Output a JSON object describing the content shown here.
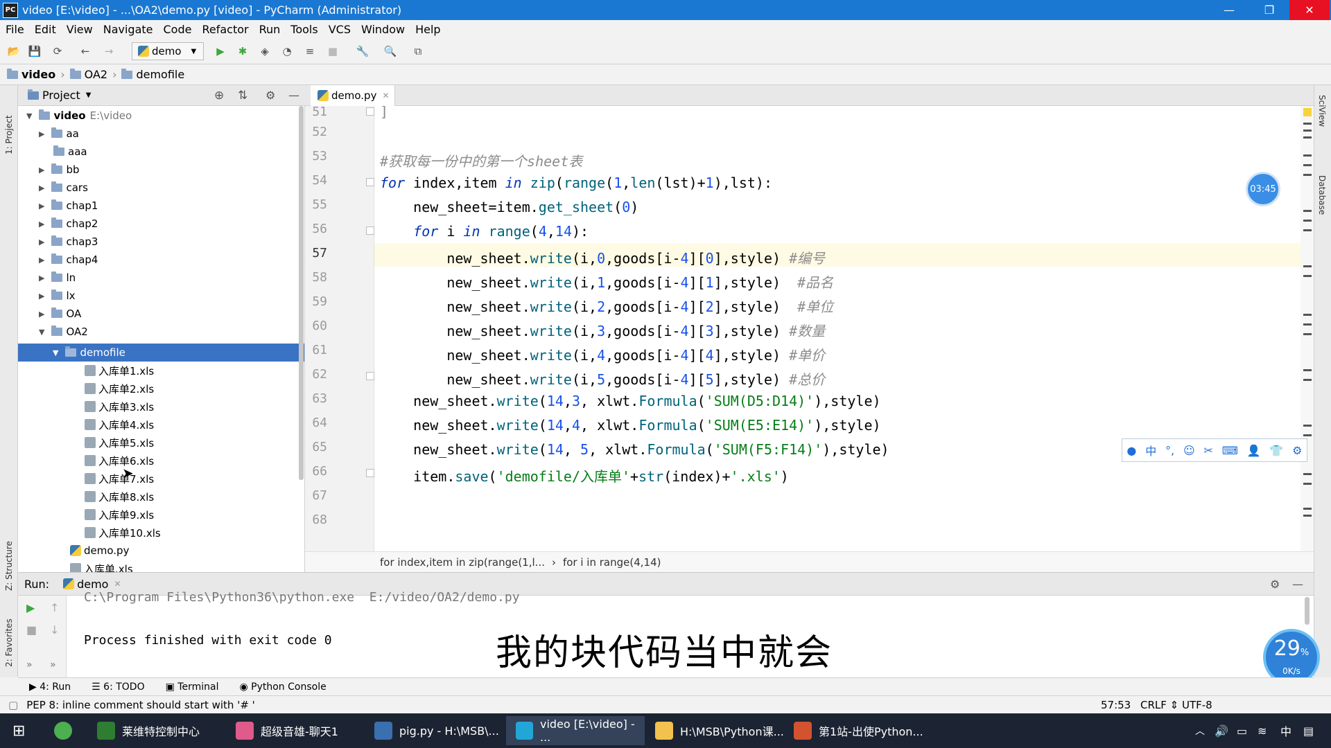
{
  "window": {
    "title": "video [E:\\video] - ...\\OA2\\demo.py [video] - PyCharm (Administrator)",
    "icon_text": "PC",
    "minimize": "—",
    "restore": "❐",
    "close": "✕"
  },
  "menu": [
    "File",
    "Edit",
    "View",
    "Navigate",
    "Code",
    "Refactor",
    "Run",
    "Tools",
    "VCS",
    "Window",
    "Help"
  ],
  "toolbar": {
    "run_config": "demo"
  },
  "navbar": {
    "crumbs": [
      "video",
      "OA2",
      "demofile"
    ]
  },
  "left_strip": {
    "project": "1: Project",
    "structure": "Z: Structure",
    "favorites": "2: Favorites"
  },
  "right_strip": {
    "sciview": "SciView",
    "database": "Database"
  },
  "project": {
    "header": "Project",
    "root": {
      "name": "video",
      "path": "E:\\video"
    },
    "items": [
      {
        "label": "aa"
      },
      {
        "label": "aaa"
      },
      {
        "label": "bb"
      },
      {
        "label": "cars"
      },
      {
        "label": "chap1"
      },
      {
        "label": "chap2"
      },
      {
        "label": "chap3"
      },
      {
        "label": "chap4"
      },
      {
        "label": "ln"
      },
      {
        "label": "lx"
      },
      {
        "label": "OA"
      },
      {
        "label": "OA2"
      },
      {
        "label": "demofile"
      },
      {
        "label": "入库单1.xls"
      },
      {
        "label": "入库单2.xls"
      },
      {
        "label": "入库单3.xls"
      },
      {
        "label": "入库单4.xls"
      },
      {
        "label": "入库单5.xls"
      },
      {
        "label": "入库单6.xls"
      },
      {
        "label": "入库单7.xls"
      },
      {
        "label": "入库单8.xls"
      },
      {
        "label": "入库单9.xls"
      },
      {
        "label": "入库单10.xls"
      },
      {
        "label": "demo.py"
      },
      {
        "label": "入库单.xls"
      }
    ]
  },
  "editor": {
    "tab": "demo.py",
    "line_numbers": [
      "51",
      "52",
      "53",
      "54",
      "55",
      "56",
      "57",
      "58",
      "59",
      "60",
      "61",
      "62",
      "63",
      "64",
      "65",
      "66",
      "67",
      "68"
    ],
    "comment_53": "#获取每一份中的第一个sheet表",
    "c57": "#编号",
    "c58": "#品名",
    "c59": "#单位",
    "c60": "#数量",
    "c61": "#单价",
    "c62": "#总价",
    "f63": "'SUM(D5:D14)'",
    "f64": "'SUM(E5:E14)'",
    "f65": "'SUM(F5:F14)'",
    "s66a": "'demofile/入库单'",
    "s66b": "'.xls'",
    "breadcrumb_1": "for index,item in zip(range(1,l...",
    "breadcrumb_2": "for i in range(4,14)",
    "timer": "03:45"
  },
  "run": {
    "label": "Run:",
    "tab": "demo",
    "cmd": "C:\\Program Files\\Python36\\python.exe  E:/video/OA2/demo.py",
    "output": "Process finished with exit code 0"
  },
  "subtitle": "我的块代码当中就会",
  "bottom_tabs": [
    "4: Run",
    "6: TODO",
    "Terminal",
    "Python Console"
  ],
  "status": {
    "message": "PEP 8: inline comment should start with '# '",
    "position": "57:53",
    "line_sep": "CRLF",
    "encoding": "UTF-8"
  },
  "net_widget": {
    "percent": "29",
    "unit": "%",
    "speed": "0K/s"
  },
  "ime": {
    "lang": "中"
  },
  "taskbar": {
    "items": [
      "莱维特控制中心",
      "超级音雄-聊天1",
      "pig.py - H:\\MSB\\...",
      "video [E:\\video] - ...",
      "H:\\MSB\\Python课...",
      "第1站-出使Python..."
    ],
    "tray_lang": "中"
  },
  "colors": {
    "titlebar": "#1a78d2",
    "selection": "#3a73c3",
    "keyword": "#0033b3",
    "function": "#00627a",
    "string": "#067d17",
    "comment": "#8c8c8c",
    "number": "#1750eb"
  }
}
